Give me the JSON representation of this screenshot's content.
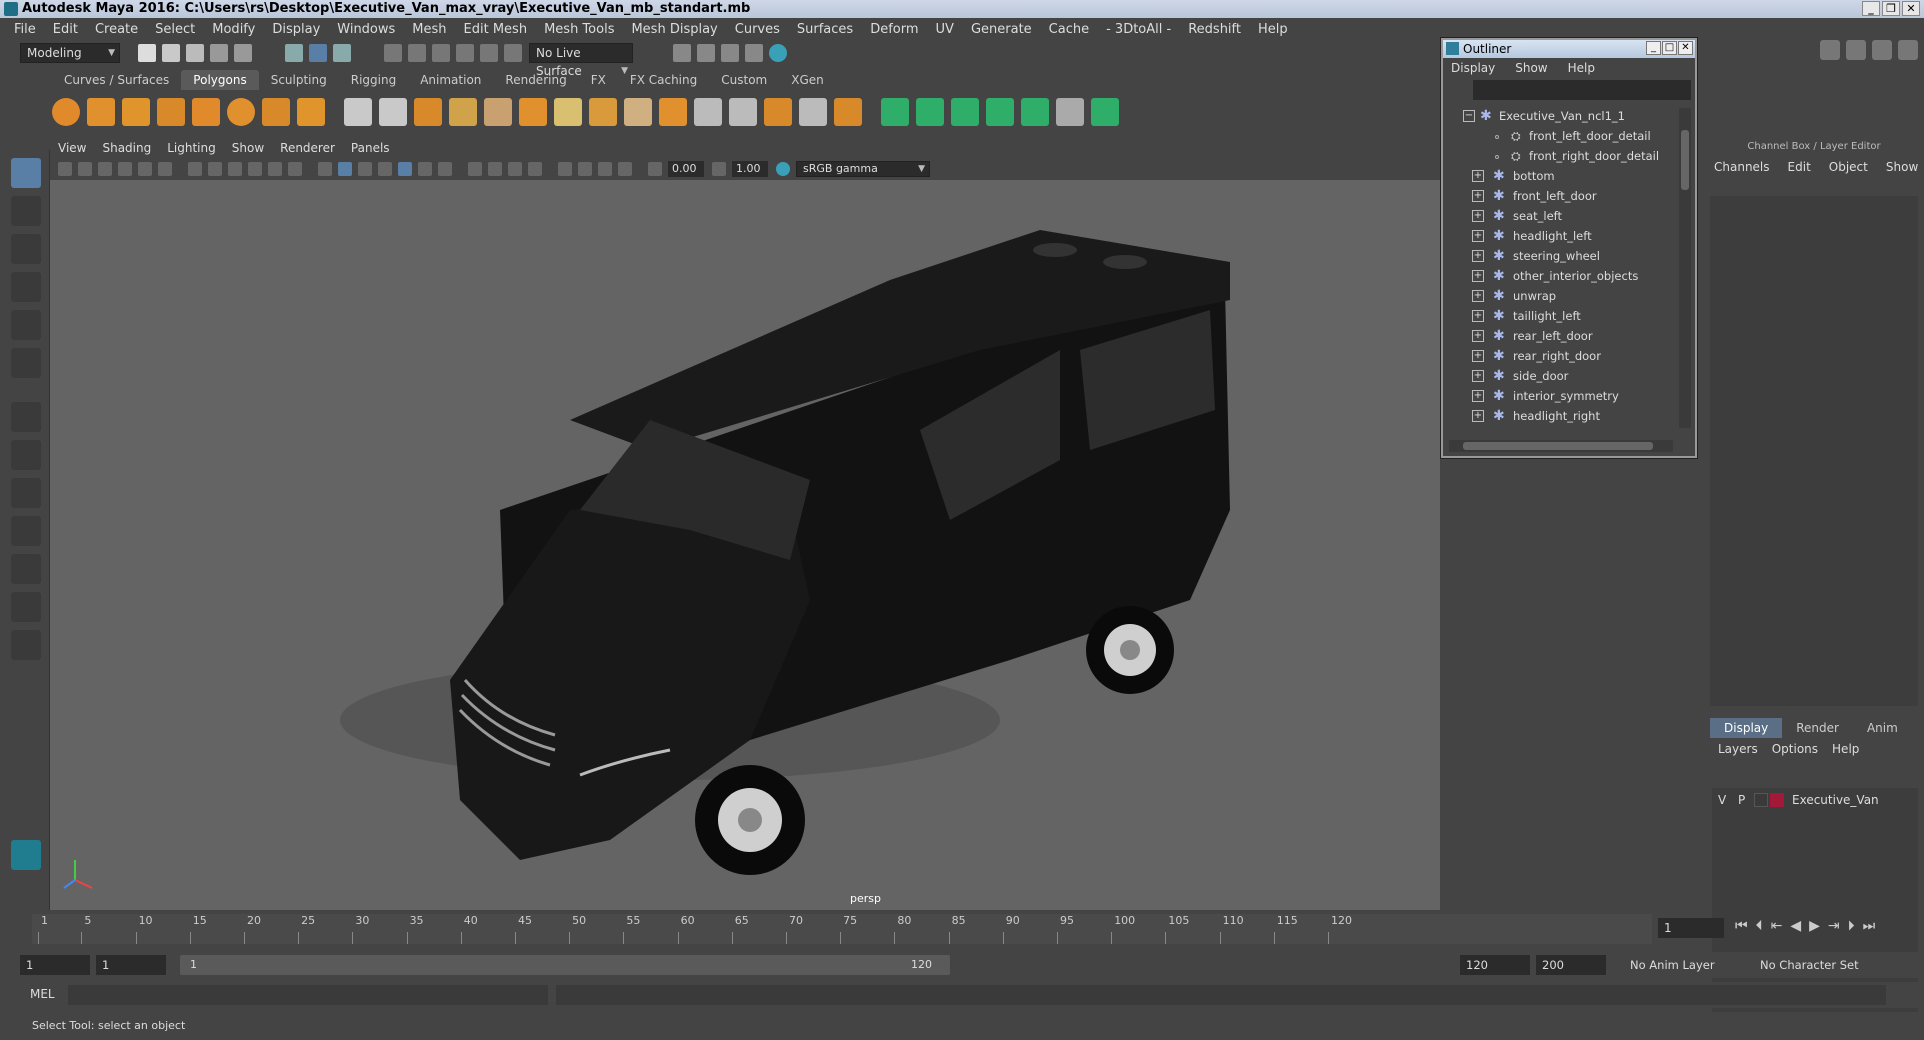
{
  "window": {
    "title": "Autodesk Maya 2016: C:\\Users\\rs\\Desktop\\Executive_Van_max_vray\\Executive_Van_mb_standart.mb"
  },
  "menubar": [
    "File",
    "Edit",
    "Create",
    "Select",
    "Modify",
    "Display",
    "Windows",
    "Mesh",
    "Edit Mesh",
    "Mesh Tools",
    "Mesh Display",
    "Curves",
    "Surfaces",
    "Deform",
    "UV",
    "Generate",
    "Cache",
    "- 3DtoAll -",
    "Redshift",
    "Help"
  ],
  "toolbar": {
    "mode": "Modeling",
    "live_surface": "No Live Surface"
  },
  "shelf_tabs": [
    {
      "label": "Curves / Surfaces",
      "active": false
    },
    {
      "label": "Polygons",
      "active": true
    },
    {
      "label": "Sculpting",
      "active": false
    },
    {
      "label": "Rigging",
      "active": false
    },
    {
      "label": "Animation",
      "active": false
    },
    {
      "label": "Rendering",
      "active": false
    },
    {
      "label": "FX",
      "active": false
    },
    {
      "label": "FX Caching",
      "active": false
    },
    {
      "label": "Custom",
      "active": false
    },
    {
      "label": "XGen",
      "active": false
    }
  ],
  "viewport": {
    "menu": [
      "View",
      "Shading",
      "Lighting",
      "Show",
      "Renderer",
      "Panels"
    ],
    "exposure": "0.00",
    "gamma": "1.00",
    "color_space": "sRGB gamma",
    "camera_label": "persp"
  },
  "outliner": {
    "title": "Outliner",
    "menu": [
      "Display",
      "Show",
      "Help"
    ],
    "root": "Executive_Van_ncl1_1",
    "children": [
      "front_left_door_detail",
      "front_right_door_detail"
    ],
    "groups": [
      "bottom",
      "front_left_door",
      "seat_left",
      "headlight_left",
      "steering_wheel",
      "other_interior_objects",
      "unwrap",
      "taillight_left",
      "rear_left_door",
      "rear_right_door",
      "side_door",
      "interior_symmetry",
      "headlight_right"
    ]
  },
  "channelbox": {
    "header": "Channel Box / Layer Editor",
    "menu": [
      "Channels",
      "Edit",
      "Object",
      "Show"
    ],
    "layer_tabs": [
      {
        "label": "Display",
        "active": true
      },
      {
        "label": "Render",
        "active": false
      },
      {
        "label": "Anim",
        "active": false
      }
    ],
    "layer_menu": [
      "Layers",
      "Options",
      "Help"
    ],
    "layer": {
      "v": "V",
      "p": "P",
      "name": "Executive_Van",
      "color": "#a2193a"
    }
  },
  "timeline": {
    "ticks": [
      "1",
      "5",
      "10",
      "15",
      "20",
      "25",
      "30",
      "35",
      "40",
      "45",
      "50",
      "55",
      "60",
      "65",
      "70",
      "75",
      "80",
      "85",
      "90",
      "95",
      "100",
      "105",
      "110",
      "115",
      "120"
    ],
    "current_frame": "1"
  },
  "range": {
    "start": "1",
    "start2": "1",
    "slider_start": "1",
    "slider_end": "120",
    "end": "120",
    "end2": "200",
    "anim_layer": "No Anim Layer",
    "char_set": "No Character Set"
  },
  "command": {
    "label": "MEL"
  },
  "status": {
    "text": "Select Tool: select an object"
  }
}
